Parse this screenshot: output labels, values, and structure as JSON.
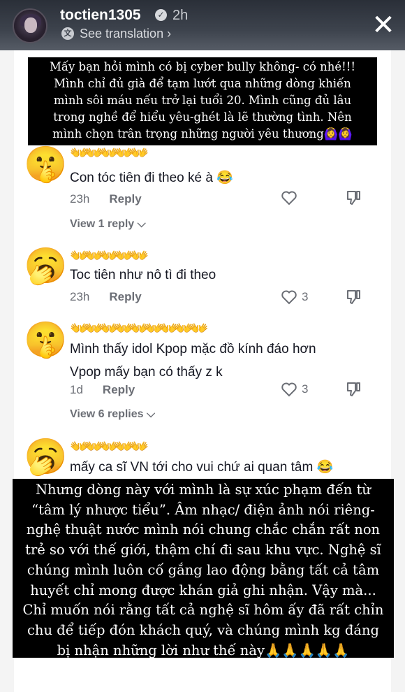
{
  "story": {
    "username": "toctien1305",
    "verified_badge": "verified-icon",
    "time": "2h",
    "see_translation": "See translation"
  },
  "caption_top": {
    "lines": [
      "Mấy bạn hỏi mình có bị cyber bully không- có nhé!!!",
      "Mình chỉ đủ già để tạm lướt qua những dòng khiến",
      "mình sôi máu nếu trở lại tuổi 20. Mình cũng đủ lâu",
      "trong nghề để hiểu yêu-ghét là lẽ thường tình. Nên",
      "mình chọn trân trọng những người yêu thương🙆‍♀️🙆‍♀️"
    ]
  },
  "comments": [
    {
      "avatar_emoji": "🤫",
      "name": "👐👐👐👐👐",
      "text_lines": [
        "Con tóc tiên đi theo ké à 😂"
      ],
      "time": "23h",
      "reply_label": "Reply",
      "likes": "",
      "view_replies": "View 1 reply"
    },
    {
      "avatar_emoji": "🥱",
      "name": "👐👐👐👐👐",
      "text_lines": [
        "Toc tiên như nô tì đi theo"
      ],
      "time": "23h",
      "reply_label": "Reply",
      "likes": "3",
      "view_replies": ""
    },
    {
      "avatar_emoji": "🤫",
      "name": "👐👐👐👐👐👐👐👐👐",
      "text_lines": [
        "Mình thấy idol Kpop mặc đồ kính đáo hơn",
        "Vpop mấy bạn có thấy z k"
      ],
      "time": "1d",
      "reply_label": "Reply",
      "likes": "3",
      "view_replies": "View 6 replies"
    },
    {
      "avatar_emoji": "🥱",
      "name": "👐👐👐👐👐",
      "text_lines": [
        "mấy ca sĩ VN tới cho vui chứ ai quan tâm 😂"
      ],
      "time": "",
      "reply_label": "",
      "likes": "",
      "view_replies": ""
    }
  ],
  "caption_bottom": {
    "lines": [
      "Nhưng dòng này với mình là sự xúc phạm đến từ",
      "“tâm lý nhược tiểu”. Âm nhạc/ điện ảnh nói riêng-",
      "nghệ thuật nước mình nói chung chắc chắn rất non",
      "trẻ so với thế giới, thậm chí đi sau khu vực. Nghệ sĩ",
      "chúng mình luôn cố gắng lao động bằng tất cả tâm",
      "huyết chỉ mong được khán giả ghi nhận. Vậy mà...",
      "Chỉ muốn nói rằng tất cả nghệ sĩ hôm ấy đã rất chỉn",
      "chu để tiếp đón khách quý, và chúng mình kg đáng",
      "bị nhận những lời như thế này🙏🙏🙏🙏🙏"
    ]
  }
}
